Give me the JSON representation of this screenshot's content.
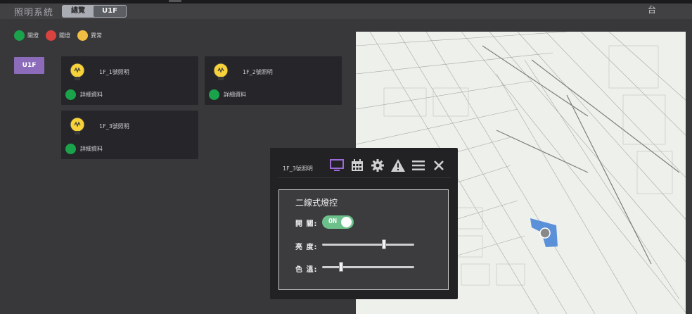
{
  "header": {
    "app_title": "照明系統",
    "tabs": [
      {
        "label": "總覽",
        "active": false
      },
      {
        "label": "U1F",
        "active": true
      }
    ],
    "right_glyph": "台"
  },
  "legend": [
    {
      "label": "開燈",
      "color": "#1aa34a"
    },
    {
      "label": "關燈",
      "color": "#d8433f"
    },
    {
      "label": "異常",
      "color": "#f0be42"
    }
  ],
  "floor_button": "U1F",
  "lights": [
    {
      "name": "1F_1號照明",
      "detail": "詳細資料",
      "status_color": "#1aa34a"
    },
    {
      "name": "1F_2號照明",
      "detail": "詳細資料",
      "status_color": "#1aa34a"
    },
    {
      "name": "1F_3號照明",
      "detail": "詳細資料",
      "status_color": "#1aa34a"
    }
  ],
  "popup": {
    "title": "1F_3號照明",
    "toolbar_icons": [
      "monitor-icon",
      "calendar-icon",
      "gear-icon",
      "warning-icon",
      "menu-icon",
      "close-icon"
    ],
    "panel_title": "二線式燈控",
    "switch_label": "開 關:",
    "switch_state": "ON",
    "brightness_label": "亮 度:",
    "brightness_value": 0.68,
    "color_temp_label": "色 溫:",
    "color_temp_value": 0.19
  },
  "colors": {
    "accent_purple": "#8c6bbb",
    "toggle_on": "#6cc08a",
    "viewer_highlight": "#4a86d6"
  }
}
